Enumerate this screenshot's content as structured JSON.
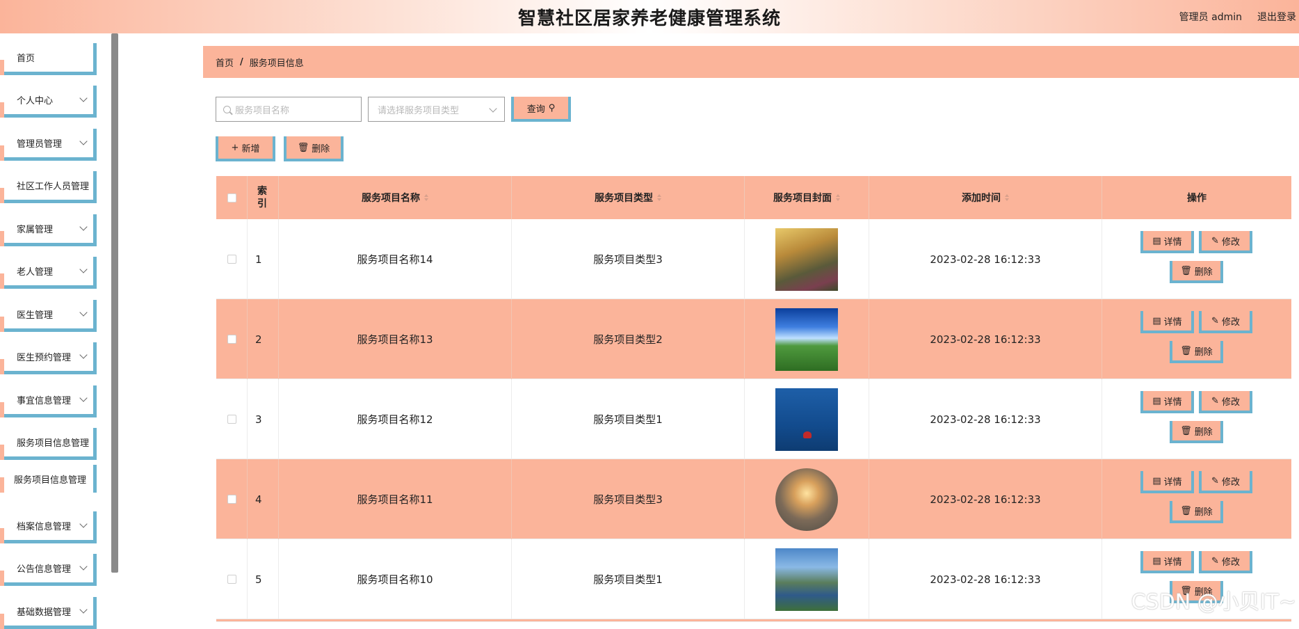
{
  "header": {
    "title": "智慧社区居家养老健康管理系统",
    "user_label": "管理员 admin",
    "logout_label": "退出登录"
  },
  "sidebar": {
    "items": [
      {
        "label": "首页",
        "has_chevron": false
      },
      {
        "label": "个人中心",
        "has_chevron": true
      },
      {
        "label": "管理员管理",
        "has_chevron": true
      },
      {
        "label": "社区工作人员管理",
        "has_chevron": false
      },
      {
        "label": "家属管理",
        "has_chevron": true
      },
      {
        "label": "老人管理",
        "has_chevron": true
      },
      {
        "label": "医生管理",
        "has_chevron": true
      },
      {
        "label": "医生预约管理",
        "has_chevron": true
      },
      {
        "label": "事宜信息管理",
        "has_chevron": true
      },
      {
        "label": "服务项目信息管理",
        "has_chevron": false
      },
      {
        "label": "服务项目信息管理",
        "is_sub": true
      },
      {
        "label": "档案信息管理",
        "has_chevron": true
      },
      {
        "label": "公告信息管理",
        "has_chevron": true
      },
      {
        "label": "基础数据管理",
        "has_chevron": true
      }
    ]
  },
  "breadcrumb": {
    "home": "首页",
    "separator": "/",
    "current": "服务项目信息"
  },
  "search": {
    "name_placeholder": "服务项目名称",
    "type_placeholder": "请选择服务项目类型",
    "query_label": "查询"
  },
  "actions": {
    "add_label": "新增",
    "delete_label": "删除"
  },
  "table": {
    "columns": [
      "索引",
      "服务项目名称",
      "服务项目类型",
      "服务项目封面",
      "添加时间",
      "操作"
    ],
    "rows": [
      {
        "index": "1",
        "name": "服务项目名称14",
        "type": "服务项目类型3",
        "cover": "img1",
        "time": "2023-02-28 16:12:33"
      },
      {
        "index": "2",
        "name": "服务项目名称13",
        "type": "服务项目类型2",
        "cover": "img2",
        "time": "2023-02-28 16:12:33"
      },
      {
        "index": "3",
        "name": "服务项目名称12",
        "type": "服务项目类型1",
        "cover": "img3",
        "time": "2023-02-28 16:12:33"
      },
      {
        "index": "4",
        "name": "服务项目名称11",
        "type": "服务项目类型3",
        "cover": "img4",
        "time": "2023-02-28 16:12:33"
      },
      {
        "index": "5",
        "name": "服务项目名称10",
        "type": "服务项目类型1",
        "cover": "img5",
        "time": "2023-02-28 16:12:33"
      }
    ],
    "op_labels": {
      "detail": "详情",
      "edit": "修改",
      "delete": "删除"
    }
  },
  "watermark": "CSDN @小贝IT~",
  "colors": {
    "accent_salmon": "#fbb49a",
    "accent_blue": "#6bb3cf"
  }
}
